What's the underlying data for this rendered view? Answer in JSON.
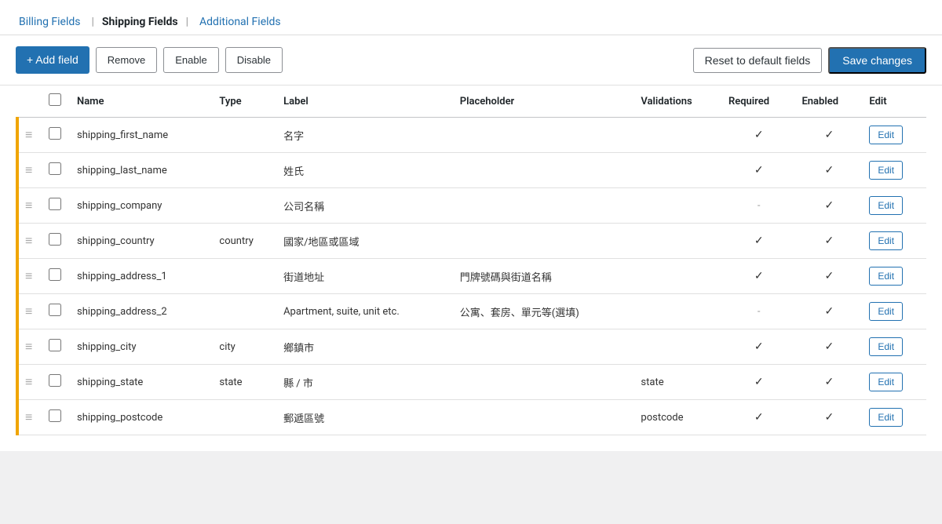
{
  "tabs": [
    {
      "label": "Billing Fields",
      "active": false,
      "id": "billing"
    },
    {
      "label": "Shipping Fields",
      "active": true,
      "id": "shipping"
    },
    {
      "label": "Additional Fields",
      "active": false,
      "id": "additional"
    }
  ],
  "toolbar": {
    "add_label": "+ Add field",
    "remove_label": "Remove",
    "enable_label": "Enable",
    "disable_label": "Disable",
    "reset_label": "Reset to default fields",
    "save_label": "Save changes"
  },
  "table": {
    "columns": [
      "",
      "",
      "Name",
      "Type",
      "Label",
      "Placeholder",
      "Validations",
      "Required",
      "Enabled",
      "Edit"
    ],
    "rows": [
      {
        "name": "shipping_first_name",
        "type": "",
        "label": "名字",
        "placeholder": "",
        "validations": "",
        "required": true,
        "enabled": true
      },
      {
        "name": "shipping_last_name",
        "type": "",
        "label": "姓氏",
        "placeholder": "",
        "validations": "",
        "required": true,
        "enabled": true
      },
      {
        "name": "shipping_company",
        "type": "",
        "label": "公司名稱",
        "placeholder": "",
        "validations": "",
        "required": false,
        "enabled": true
      },
      {
        "name": "shipping_country",
        "type": "country",
        "label": "國家/地區或區域",
        "placeholder": "",
        "validations": "",
        "required": true,
        "enabled": true
      },
      {
        "name": "shipping_address_1",
        "type": "",
        "label": "街道地址",
        "placeholder": "門牌號碼與街道名稱",
        "validations": "",
        "required": true,
        "enabled": true
      },
      {
        "name": "shipping_address_2",
        "type": "",
        "label": "Apartment, suite, unit etc.",
        "placeholder": "公寓、套房、單元等(選填)",
        "validations": "",
        "required": false,
        "enabled": true
      },
      {
        "name": "shipping_city",
        "type": "city",
        "label": "鄉鎮市",
        "placeholder": "",
        "validations": "",
        "required": true,
        "enabled": true
      },
      {
        "name": "shipping_state",
        "type": "state",
        "label": "縣 / 市",
        "placeholder": "",
        "validations": "state",
        "required": true,
        "enabled": true
      },
      {
        "name": "shipping_postcode",
        "type": "",
        "label": "郵遞區號",
        "placeholder": "",
        "validations": "postcode",
        "required": true,
        "enabled": true
      }
    ],
    "edit_label": "Edit"
  }
}
